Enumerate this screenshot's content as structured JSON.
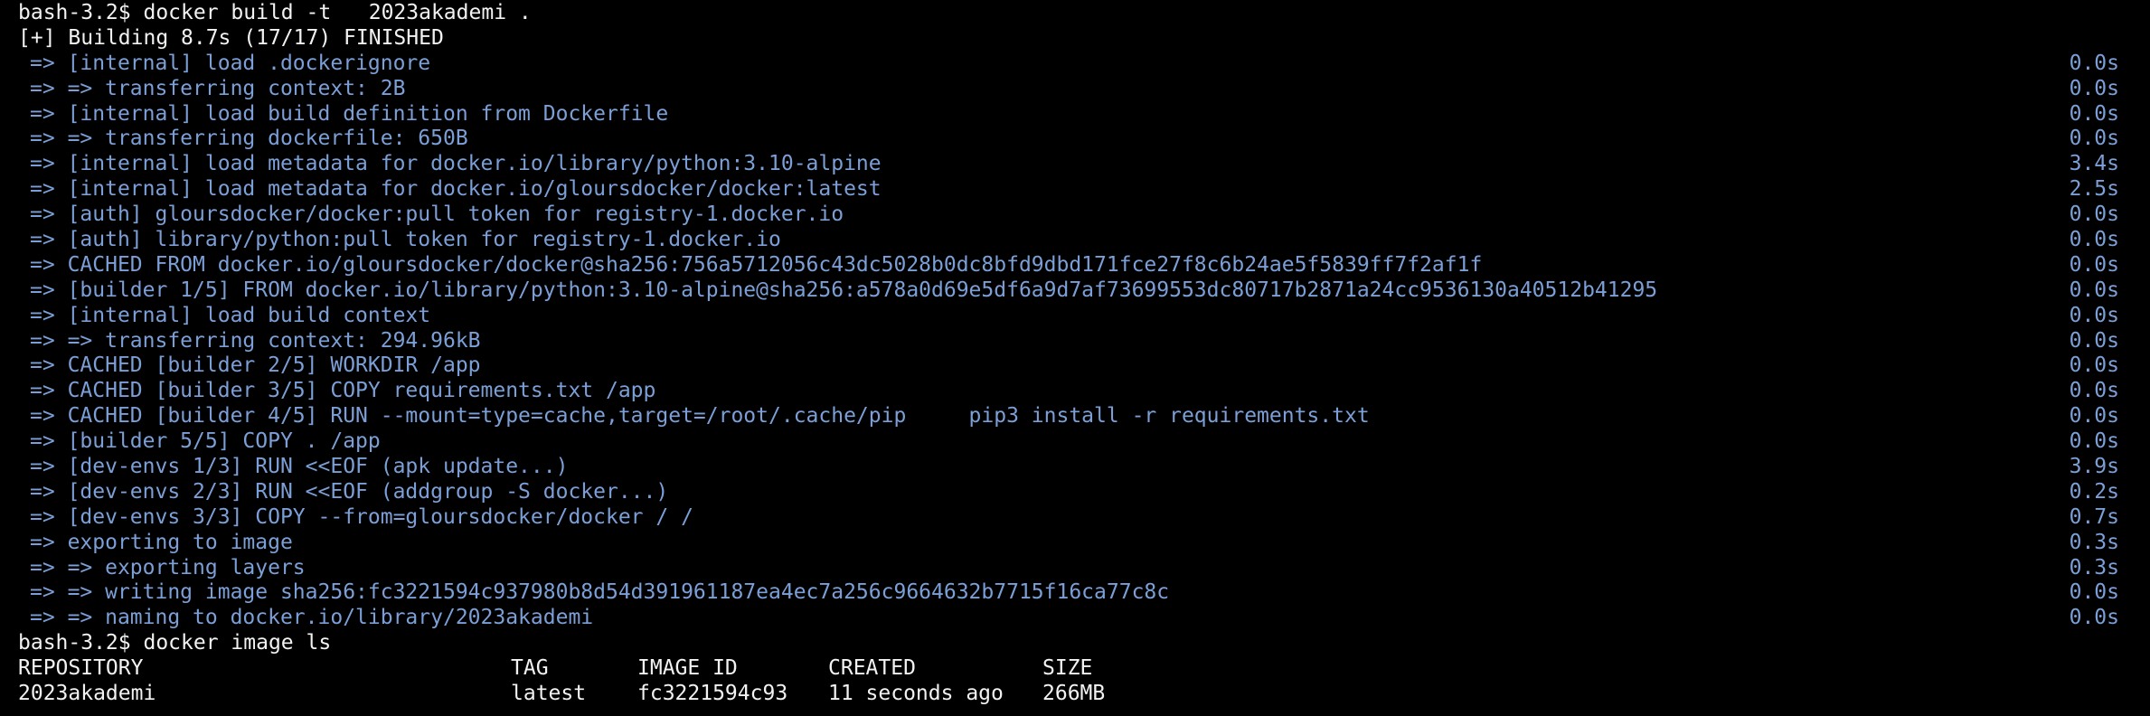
{
  "colors": {
    "background": "#000000",
    "foreground": "#f2f2f2",
    "build_step": "#7b9fd6"
  },
  "terminal": {
    "prompt_1": "bash-3.2$ docker build -t   2023akademi .",
    "build_status": "[+] Building 8.7s (17/17) FINISHED",
    "steps": [
      {
        "arrow": "=>",
        "text": "[internal] load .dockerignore",
        "time": "0.0s"
      },
      {
        "arrow": "=>",
        "text": "=> transferring context: 2B",
        "time": "0.0s"
      },
      {
        "arrow": "=>",
        "text": "[internal] load build definition from Dockerfile",
        "time": "0.0s"
      },
      {
        "arrow": "=>",
        "text": "=> transferring dockerfile: 650B",
        "time": "0.0s"
      },
      {
        "arrow": "=>",
        "text": "[internal] load metadata for docker.io/library/python:3.10-alpine",
        "time": "3.4s"
      },
      {
        "arrow": "=>",
        "text": "[internal] load metadata for docker.io/gloursdocker/docker:latest",
        "time": "2.5s"
      },
      {
        "arrow": "=>",
        "text": "[auth] gloursdocker/docker:pull token for registry-1.docker.io",
        "time": "0.0s"
      },
      {
        "arrow": "=>",
        "text": "[auth] library/python:pull token for registry-1.docker.io",
        "time": "0.0s"
      },
      {
        "arrow": "=>",
        "text": "CACHED FROM docker.io/gloursdocker/docker@sha256:756a5712056c43dc5028b0dc8bfd9dbd171fce27f8c6b24ae5f5839ff7f2af1f",
        "time": "0.0s"
      },
      {
        "arrow": "=>",
        "text": "[builder 1/5] FROM docker.io/library/python:3.10-alpine@sha256:a578a0d69e5df6a9d7af73699553dc80717b2871a24cc9536130a40512b41295",
        "time": "0.0s"
      },
      {
        "arrow": "=>",
        "text": "[internal] load build context",
        "time": "0.0s"
      },
      {
        "arrow": "=>",
        "text": "=> transferring context: 294.96kB",
        "time": "0.0s"
      },
      {
        "arrow": "=>",
        "text": "CACHED [builder 2/5] WORKDIR /app",
        "time": "0.0s"
      },
      {
        "arrow": "=>",
        "text": "CACHED [builder 3/5] COPY requirements.txt /app",
        "time": "0.0s"
      },
      {
        "arrow": "=>",
        "text": "CACHED [builder 4/5] RUN --mount=type=cache,target=/root/.cache/pip     pip3 install -r requirements.txt",
        "time": "0.0s"
      },
      {
        "arrow": "=>",
        "text": "[builder 5/5] COPY . /app",
        "time": "0.0s"
      },
      {
        "arrow": "=>",
        "text": "[dev-envs 1/3] RUN <<EOF (apk update...)",
        "time": "3.9s"
      },
      {
        "arrow": "=>",
        "text": "[dev-envs 2/3] RUN <<EOF (addgroup -S docker...)",
        "time": "0.2s"
      },
      {
        "arrow": "=>",
        "text": "[dev-envs 3/3] COPY --from=gloursdocker/docker / /",
        "time": "0.7s"
      },
      {
        "arrow": "=>",
        "text": "exporting to image",
        "time": "0.3s"
      },
      {
        "arrow": "=>",
        "text": "=> exporting layers",
        "time": "0.3s"
      },
      {
        "arrow": "=>",
        "text": "=> writing image sha256:fc3221594c937980b8d54d391961187ea4ec7a256c9664632b7715f16ca77c8c",
        "time": "0.0s"
      },
      {
        "arrow": "=>",
        "text": "=> naming to docker.io/library/2023akademi",
        "time": "0.0s"
      }
    ],
    "prompt_2": "bash-3.2$ docker image ls",
    "table": {
      "headers": [
        "REPOSITORY",
        "TAG",
        "IMAGE ID",
        "CREATED",
        "SIZE"
      ],
      "rows": [
        [
          "2023akademi",
          "latest",
          "fc3221594c93",
          "11 seconds ago",
          "266MB"
        ]
      ]
    }
  }
}
